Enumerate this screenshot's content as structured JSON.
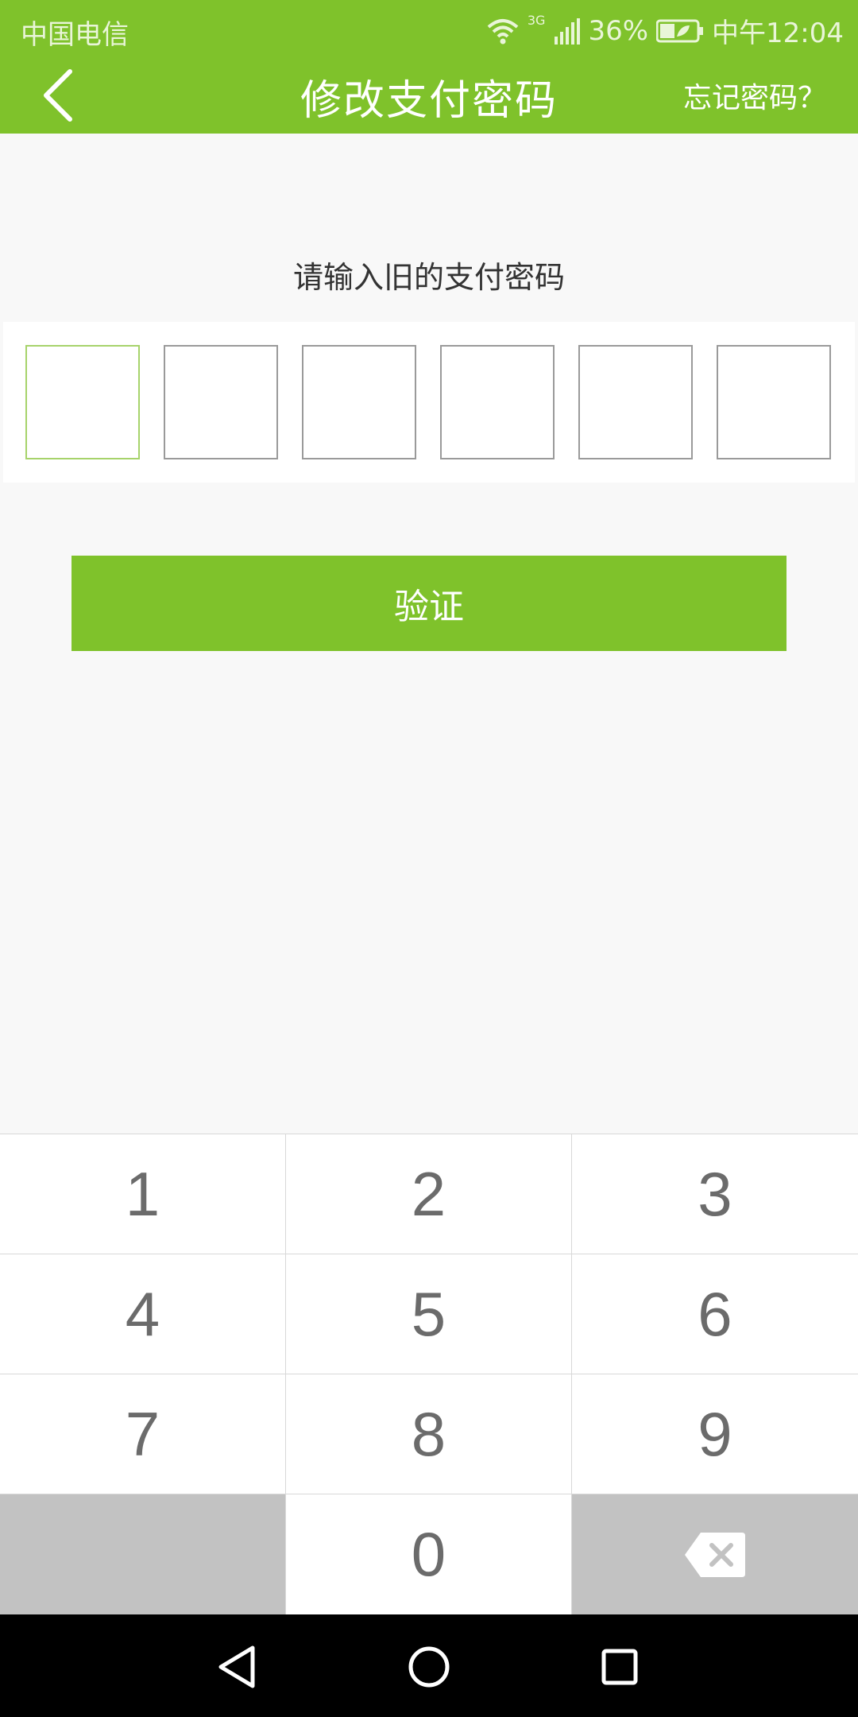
{
  "statusbar": {
    "carrier": "中国电信",
    "network": "3G",
    "battery": "36%",
    "time": "中午12:04"
  },
  "navbar": {
    "title": "修改支付密码",
    "forgot_label": "忘记密码？"
  },
  "pin": {
    "prompt": "请输入旧的支付密码",
    "length": 6,
    "active_index": 0
  },
  "verify_label": "验证",
  "keypad": {
    "keys": [
      "1",
      "2",
      "3",
      "4",
      "5",
      "6",
      "7",
      "8",
      "9",
      "",
      "0",
      "⌫"
    ]
  },
  "colors": {
    "brand_green": "#7fc22b",
    "background": "#f8f8f8",
    "key_gray": "#c2c2c2"
  }
}
